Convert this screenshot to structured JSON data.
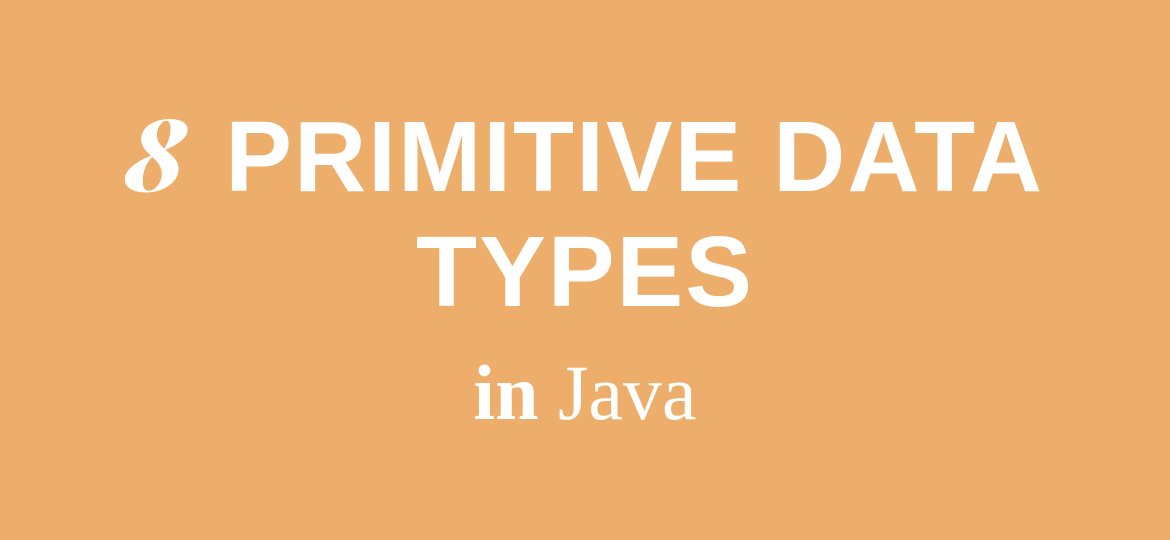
{
  "heading": {
    "number": "8",
    "line1_text": " Primitive Data",
    "line2_text": "Types",
    "line3_in": "in",
    "line3_java": " Java"
  },
  "colors": {
    "background": "#eeae6b",
    "text": "#ffffff"
  }
}
